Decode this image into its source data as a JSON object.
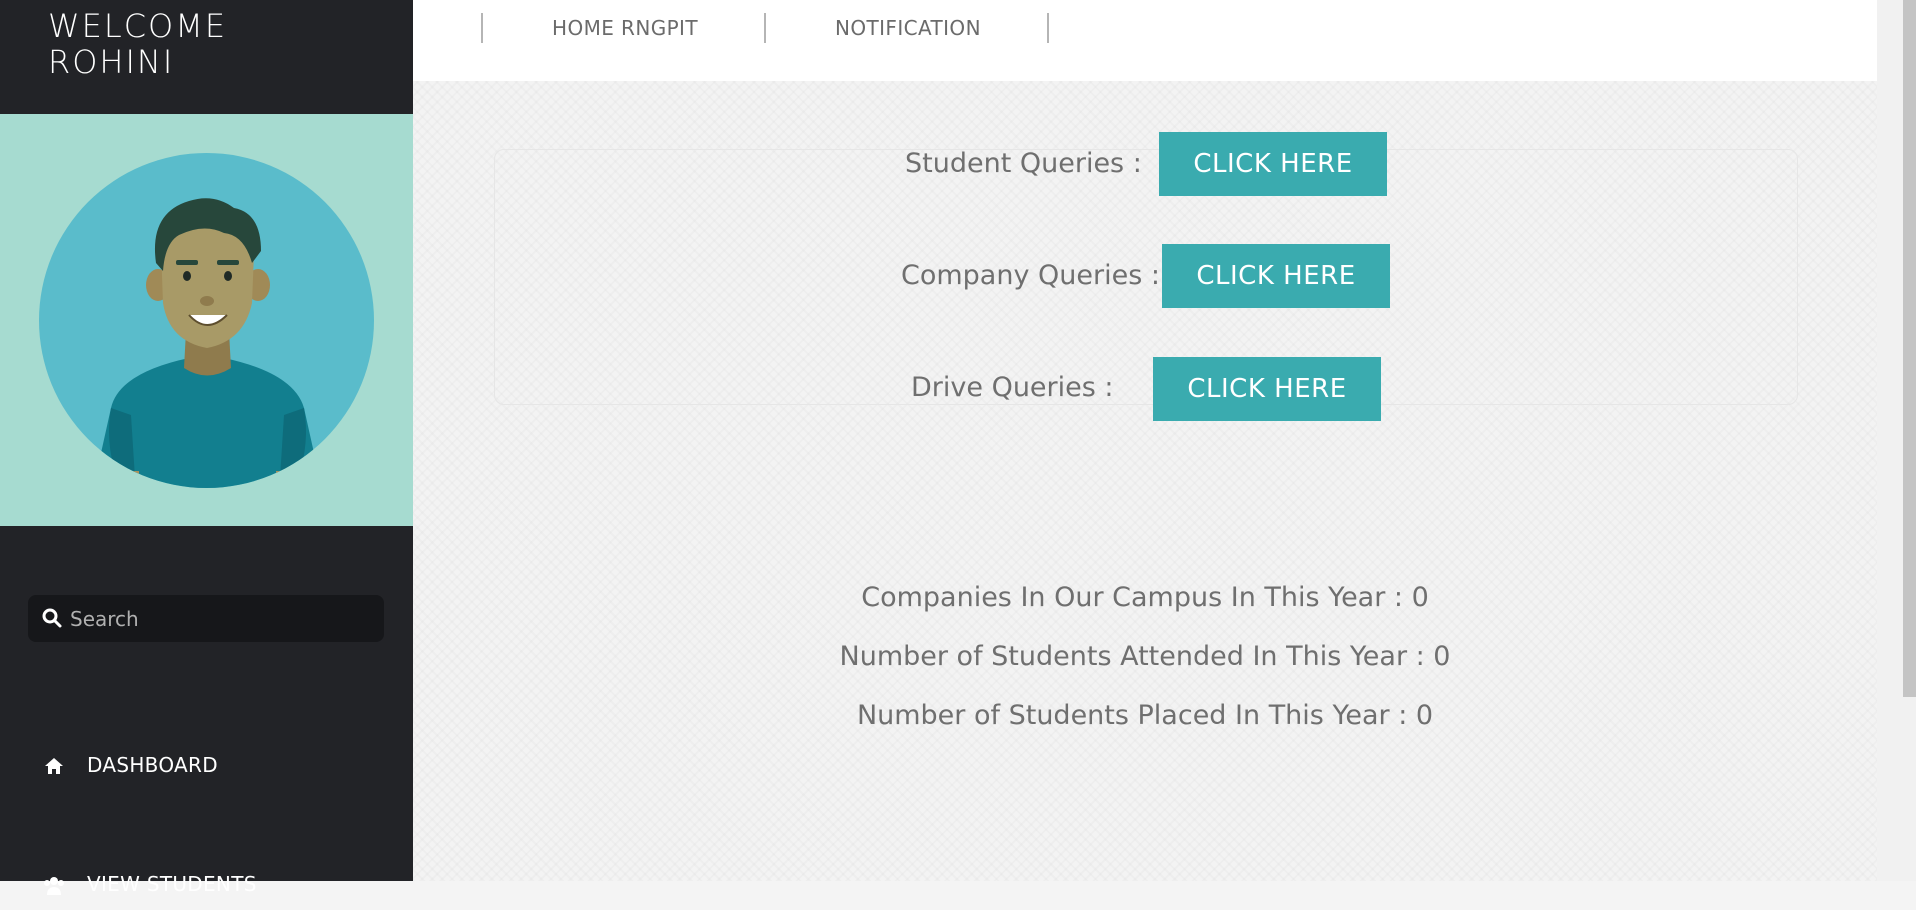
{
  "sidebar": {
    "welcome_line1": "WELCOME",
    "welcome_line2": "ROHINI",
    "search_placeholder": "Search",
    "nav": [
      {
        "label": "DASHBOARD",
        "icon": "home-icon"
      },
      {
        "label": "VIEW STUDENTS",
        "icon": "users-icon"
      }
    ]
  },
  "topnav": {
    "links": [
      "HOME RNGPIT",
      "NOTIFICATION"
    ]
  },
  "queries": [
    {
      "label": "Student Queries :",
      "button": "CLICK HERE"
    },
    {
      "label": "Company Queries :",
      "button": "CLICK HERE"
    },
    {
      "label": "Drive Queries :",
      "button": "CLICK HERE"
    }
  ],
  "stats": [
    "Companies In Our Campus In This Year : 0",
    "Number of Students Attended In This Year : 0",
    "Number of Students Placed In This Year : 0"
  ],
  "colors": {
    "sidebar_bg": "#222327",
    "avatar_panel_bg": "#a6dbd0",
    "button_bg": "#3aabaf",
    "text_gray": "#6f6f6f"
  }
}
